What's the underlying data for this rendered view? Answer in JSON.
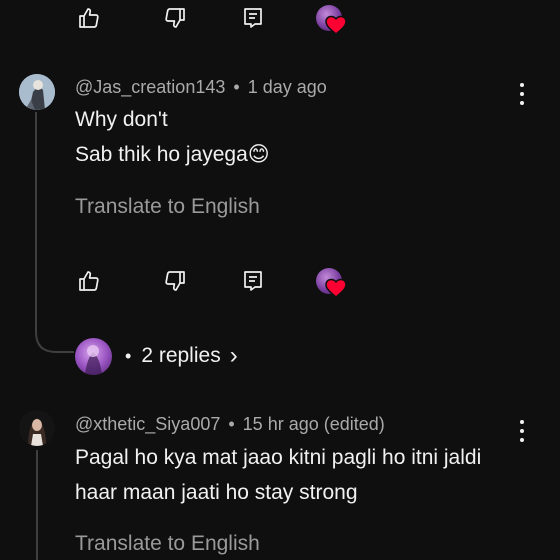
{
  "top_actions": {
    "like_icon": "thumb-up-outline",
    "dislike_icon": "thumb-down-outline",
    "reply_icon": "reply-comment-box",
    "hearted_icon": "creator-heart"
  },
  "comment1": {
    "handle": "@Jas_creation143",
    "separator": "•",
    "time": "1 day ago",
    "line1": "Why don't",
    "line2": "Sab thik ho jayega",
    "emoji": "😊",
    "translate": "Translate to English",
    "replies_bullet": "•",
    "replies_label": "2 replies",
    "replies_chevron": "›"
  },
  "comment2": {
    "handle": "@xthetic_Siya007",
    "separator": "•",
    "time": "15 hr ago (edited)",
    "line1": "Pagal ho kya mat jaao kitni pagli ho itni jaldi",
    "line2": "haar maan jaati ho stay strong",
    "translate": "Translate to English"
  },
  "colors": {
    "background": "#0f0f0f",
    "text_primary": "#f1f1f1",
    "text_secondary": "#aaaaaa",
    "heart": "#ff0033"
  }
}
